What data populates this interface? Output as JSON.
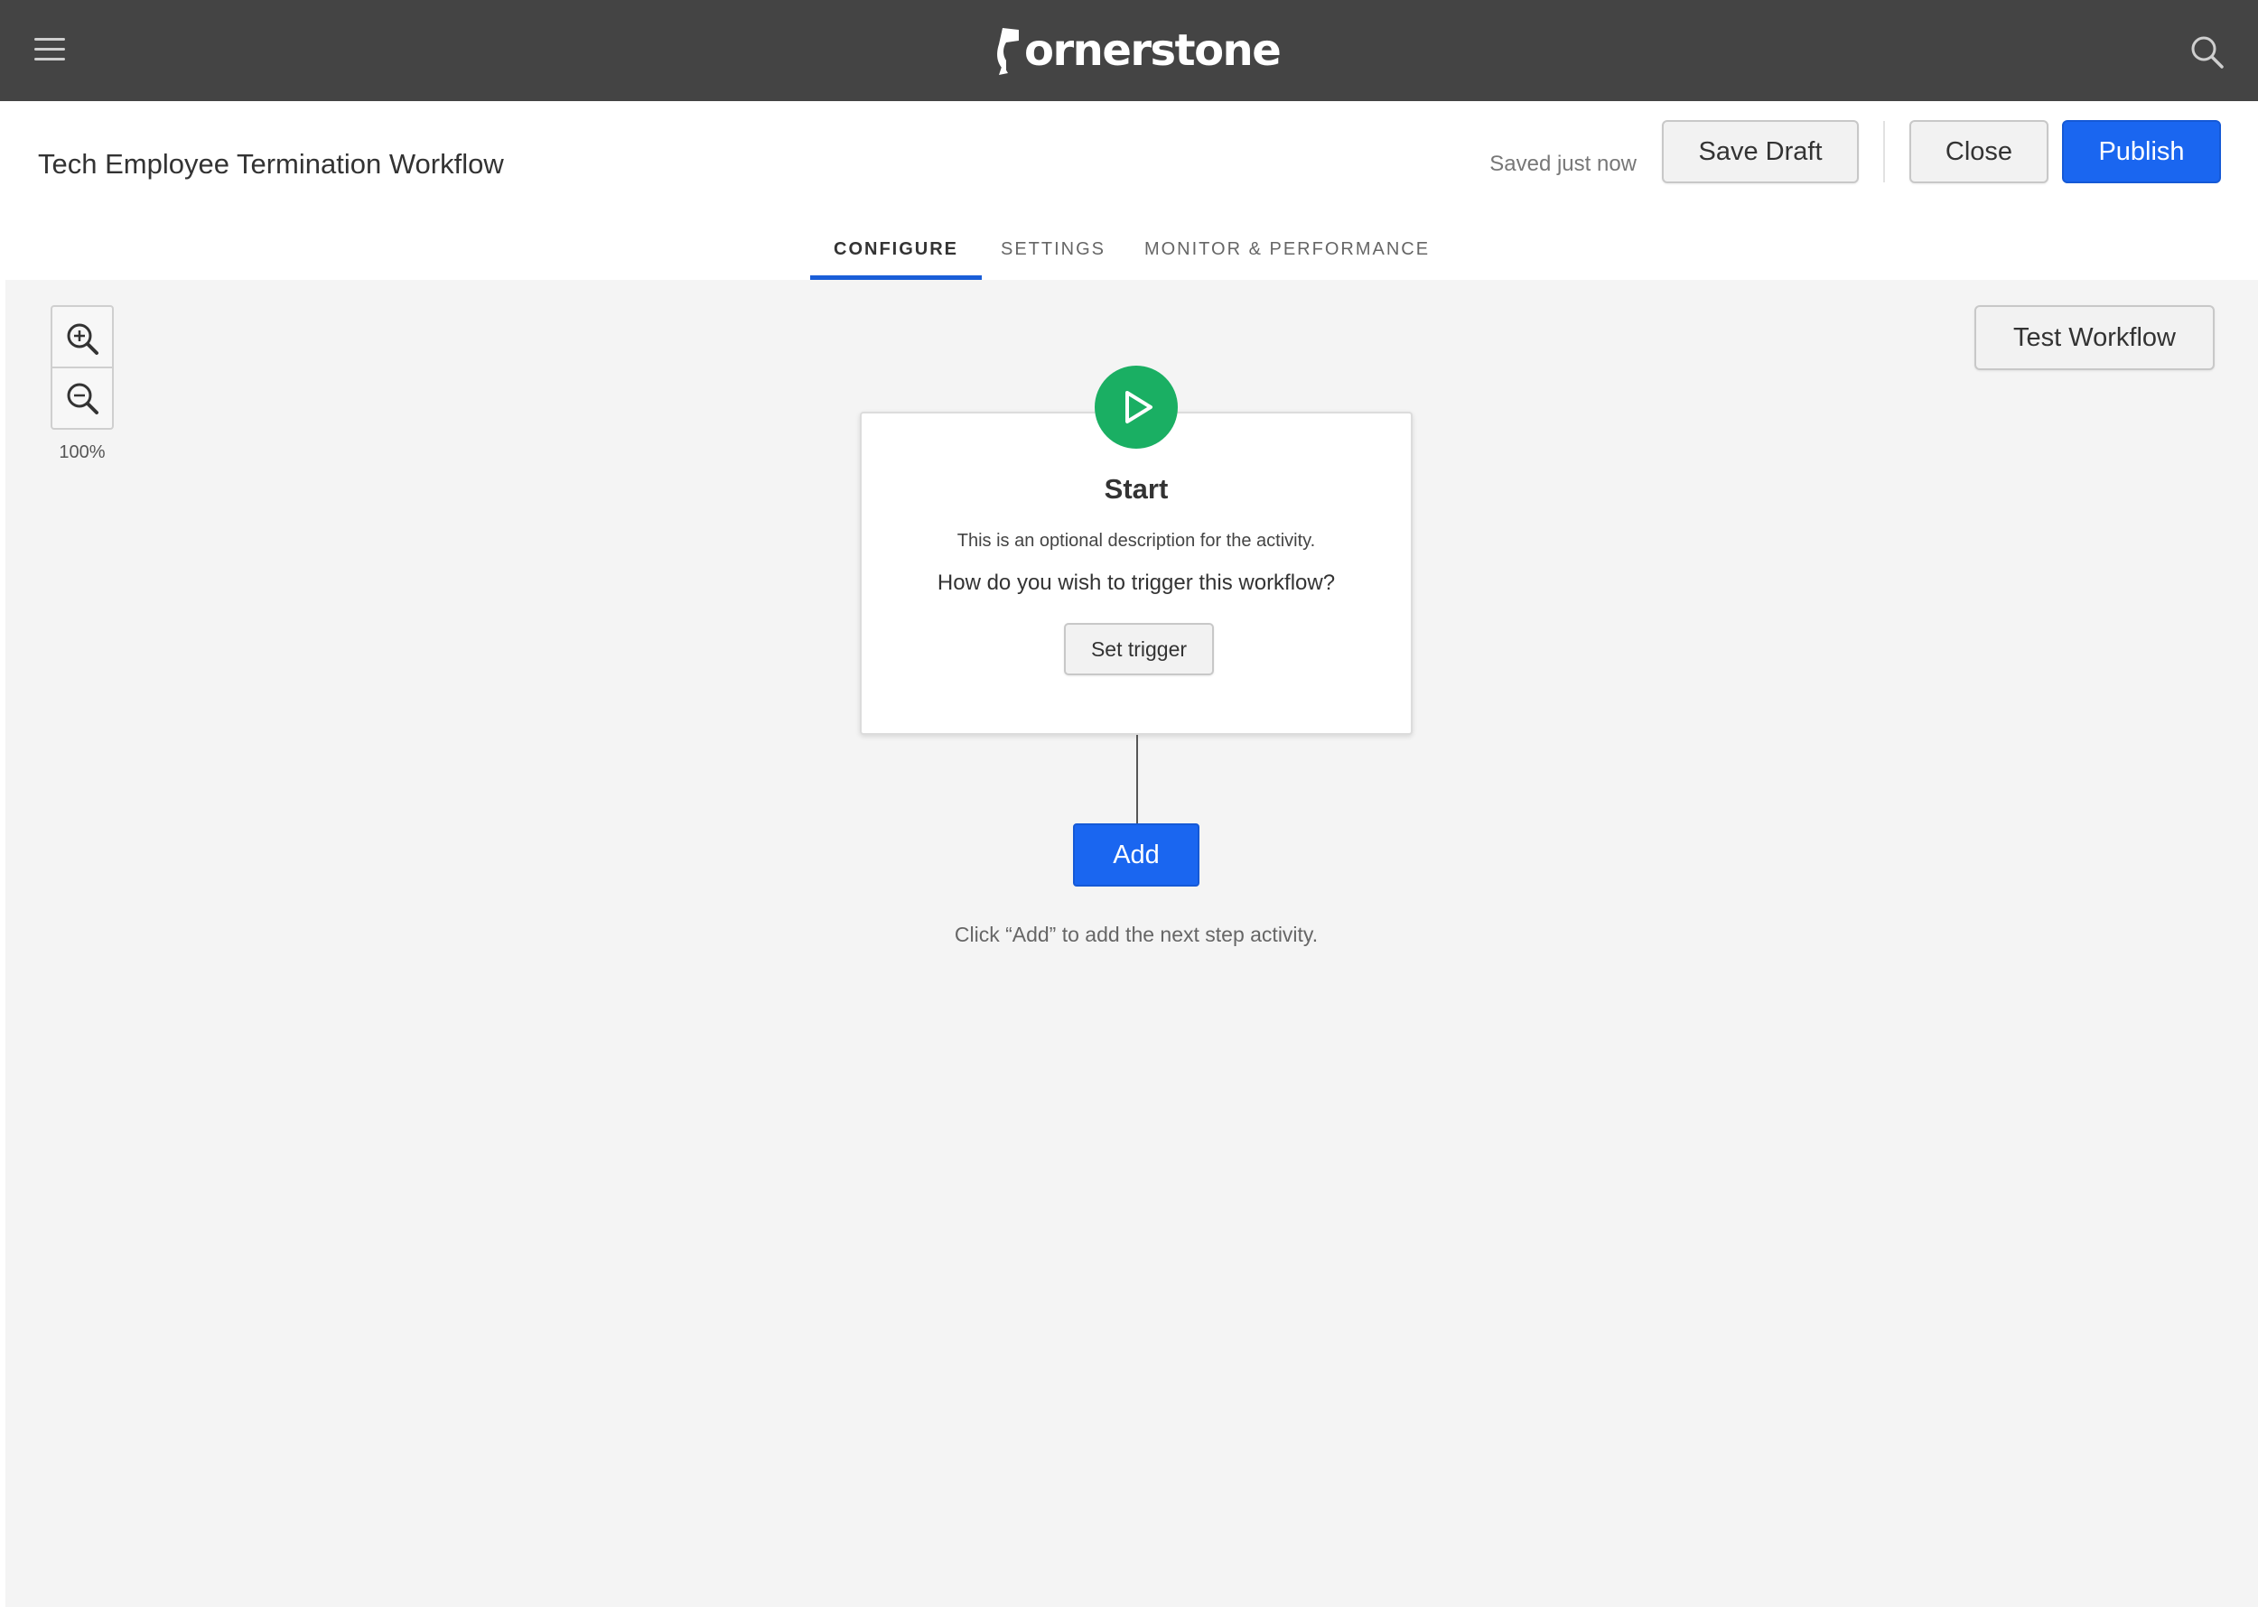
{
  "topbar": {
    "brand": "ornerstone",
    "menu_icon": "hamburger-menu-icon",
    "search_icon": "search-icon",
    "background": "#444444"
  },
  "header": {
    "title": "Tech Employee Termination Workflow",
    "save_status": "Saved just now",
    "save_draft_label": "Save Draft",
    "close_label": "Close",
    "publish_label": "Publish"
  },
  "tabs": [
    {
      "label": "CONFIGURE",
      "active": true
    },
    {
      "label": "SETTINGS",
      "active": false
    },
    {
      "label": "MONITOR & PERFORMANCE",
      "active": false
    }
  ],
  "canvas": {
    "zoom_level": "100%",
    "zoom_in_icon": "zoom-in-icon",
    "zoom_out_icon": "zoom-out-icon",
    "test_workflow_label": "Test Workflow",
    "start_node": {
      "icon": "play-icon",
      "title": "Start",
      "description": "This is an optional description for the activity.",
      "question": "How do you wish to trigger this workflow?",
      "set_trigger_label": "Set trigger"
    },
    "add_label": "Add",
    "hint": "Click “Add” to add the next step activity."
  },
  "colors": {
    "primary": "#1a66f0",
    "tab_indicator": "#1a5ed8",
    "start_green": "#1aaf63",
    "canvas_bg": "#f4f4f4"
  }
}
